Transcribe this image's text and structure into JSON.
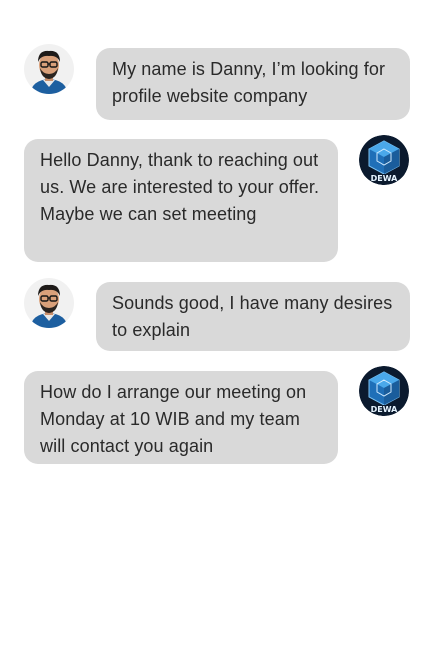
{
  "messages": [
    {
      "sender": "user",
      "text": "My name is Danny, I’m looking for profile website company"
    },
    {
      "sender": "company",
      "text": "Hello Danny, thank to reaching out us. We are interested to your offer. Maybe we can set meeting"
    },
    {
      "sender": "user",
      "text": "Sounds good, I have many desires to explain"
    },
    {
      "sender": "company",
      "text": "How do I arrange our meeting on Monday at 10 WIB and my team will contact you again"
    }
  ],
  "company_avatar_text": "DEWA",
  "colors": {
    "bubble": "#d9d9d9",
    "text": "#2a2a2a",
    "company_avatar_bg": "#0b1a2e",
    "company_logo": "#2b8fd8"
  }
}
